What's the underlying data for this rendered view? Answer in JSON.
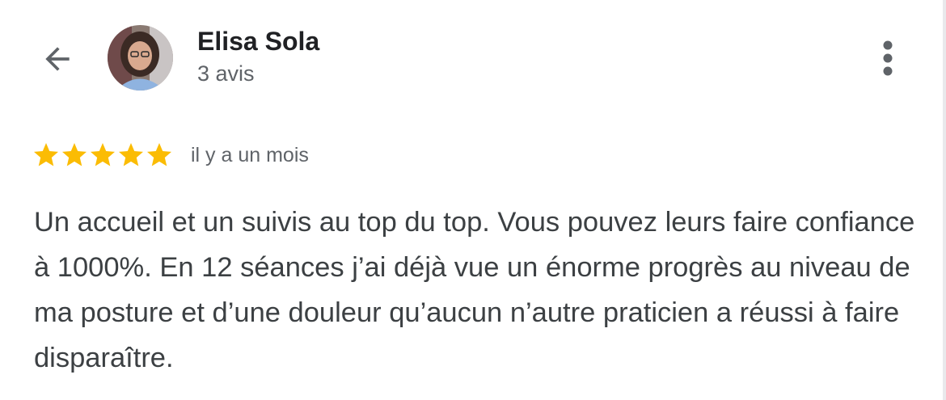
{
  "header": {
    "back_icon": "arrow-left-icon",
    "user_name": "Elisa Sola",
    "review_count": "3 avis",
    "more_icon": "more-vertical-icon"
  },
  "review": {
    "rating": 5,
    "rating_max": 5,
    "date": "il y a un mois",
    "text": "Un accueil et un suivis au top du top. Vous pouvez leurs faire confiance à 1000%. En 12 séances j’ai déjà vue un énorme progrès au niveau de ma posture et d’une douleur qu’aucun n’autre praticien a réussi à faire disparaître."
  },
  "colors": {
    "star": "#FBBC04",
    "name_text": "#202124",
    "secondary_text": "#5f6368",
    "body_text": "#3c4043",
    "icon": "#5f6368"
  }
}
